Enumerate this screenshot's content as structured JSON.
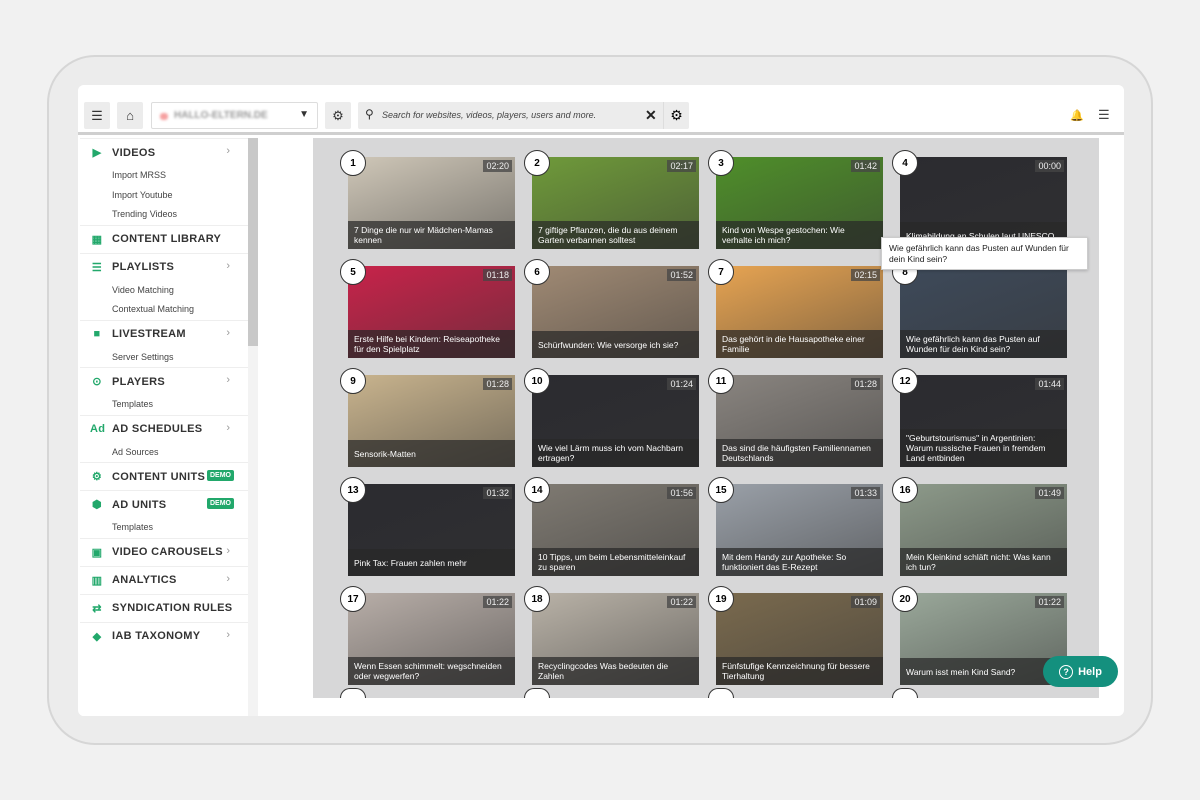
{
  "header": {
    "search_placeholder": "Search for websites, videos, players, users and more.",
    "site_selected": "HALLO-ELTERN.DE"
  },
  "sidebar": [
    {
      "label": "VIDEOS",
      "icon": "video-icon",
      "glyph": "▶",
      "chev": true,
      "subs": [
        "Import MRSS",
        "Import Youtube",
        "Trending Videos"
      ]
    },
    {
      "label": "CONTENT LIBRARY",
      "icon": "film-icon",
      "glyph": "▦",
      "chev": false,
      "subs": []
    },
    {
      "label": "PLAYLISTS",
      "icon": "list-icon",
      "glyph": "☰",
      "chev": true,
      "subs": [
        "Video Matching",
        "Contextual Matching"
      ]
    },
    {
      "label": "LIVESTREAM",
      "icon": "camera-icon",
      "glyph": "■",
      "chev": true,
      "subs": [
        "Server Settings"
      ]
    },
    {
      "label": "PLAYERS",
      "icon": "play-circle-icon",
      "glyph": "⊙",
      "chev": true,
      "subs": [
        "Templates"
      ]
    },
    {
      "label": "AD SCHEDULES",
      "icon": "ad-icon",
      "glyph": "Ad",
      "chev": true,
      "subs": [
        "Ad Sources"
      ]
    },
    {
      "label": "CONTENT UNITS",
      "icon": "gears-icon",
      "glyph": "⚙",
      "chev": false,
      "badge": "DEMO",
      "subs": []
    },
    {
      "label": "AD UNITS",
      "icon": "cube-icon",
      "glyph": "⬢",
      "chev": false,
      "badge": "DEMO",
      "subs": [
        "Templates"
      ]
    },
    {
      "label": "VIDEO CAROUSELS",
      "icon": "carousel-icon",
      "glyph": "▣",
      "chev": true,
      "subs": []
    },
    {
      "label": "ANALYTICS",
      "icon": "bar-chart-icon",
      "glyph": "▥",
      "chev": true,
      "subs": []
    },
    {
      "label": "SYNDICATION RULES",
      "icon": "exchange-icon",
      "glyph": "⇄",
      "chev": false,
      "subs": []
    },
    {
      "label": "IAB TAXONOMY",
      "icon": "tag-icon",
      "glyph": "◆",
      "chev": true,
      "subs": []
    }
  ],
  "videos": [
    {
      "n": "1",
      "dur": "02:20",
      "title": "7 Dinge die nur wir Mädchen-Mamas kennen",
      "bg": "#cfc7b8"
    },
    {
      "n": "2",
      "dur": "02:17",
      "title": "7 giftige Pflanzen, die du aus deinem Garten verbannen solltest",
      "bg": "#6f9a3a"
    },
    {
      "n": "3",
      "dur": "01:42",
      "title": "Kind von Wespe gestochen: Wie verhalte ich mich?",
      "bg": "#4f8f2a"
    },
    {
      "n": "4",
      "dur": "00:00",
      "title": "Klimabildung an Schulen laut UNESCO",
      "bg": "#2b2b30"
    },
    {
      "n": "5",
      "dur": "01:18",
      "title": "Erste Hilfe bei Kindern: Reiseapotheke für den Spielplatz",
      "bg": "#c8234a"
    },
    {
      "n": "6",
      "dur": "01:52",
      "title": "Schürfwunden: Wie versorge ich sie?",
      "bg": "#a08a74"
    },
    {
      "n": "7",
      "dur": "02:15",
      "title": "Das gehört in die Hausapotheke einer Familie",
      "bg": "#e7a452"
    },
    {
      "n": "8",
      "dur": "",
      "title": "Wie gefährlich kann das Pusten auf Wunden für dein Kind sein?",
      "bg": "#3e4a5a"
    },
    {
      "n": "9",
      "dur": "01:28",
      "title": "Sensorik-Matten",
      "bg": "#c9b48e"
    },
    {
      "n": "10",
      "dur": "01:24",
      "title": "Wie viel Lärm muss ich vom Nachbarn ertragen?",
      "bg": "#2b2b30"
    },
    {
      "n": "11",
      "dur": "01:28",
      "title": "Das sind die häufigsten Familiennamen Deutschlands",
      "bg": "#8a8580"
    },
    {
      "n": "12",
      "dur": "01:44",
      "title": "\"Geburtstourismus\" in Argentinien: Warum russische Frauen in fremdem Land entbinden",
      "bg": "#2b2b30"
    },
    {
      "n": "13",
      "dur": "01:32",
      "title": "Pink Tax: Frauen zahlen mehr",
      "bg": "#2b2b30"
    },
    {
      "n": "14",
      "dur": "01:56",
      "title": "10 Tipps, um beim Lebensmitteleinkauf zu sparen",
      "bg": "#7f7a72"
    },
    {
      "n": "15",
      "dur": "01:33",
      "title": "Mit dem Handy zur Apotheke: So funktioniert das E-Rezept",
      "bg": "#9aa0a8"
    },
    {
      "n": "16",
      "dur": "01:49",
      "title": "Mein Kleinkind schläft nicht: Was kann ich tun?",
      "bg": "#8d9a8a"
    },
    {
      "n": "17",
      "dur": "01:22",
      "title": "Wenn Essen schimmelt: wegschneiden oder wegwerfen?",
      "bg": "#b8aea8"
    },
    {
      "n": "18",
      "dur": "01:22",
      "title": "Recyclingcodes Was bedeuten die Zahlen",
      "bg": "#b9b2a7"
    },
    {
      "n": "19",
      "dur": "01:09",
      "title": "Fünfstufige Kennzeichnung für bessere Tierhaltung",
      "bg": "#7a6a4e"
    },
    {
      "n": "20",
      "dur": "01:22",
      "title": "Warum isst mein Kind Sand?",
      "bg": "#9aa89a"
    }
  ],
  "tooltip": "Wie gefährlich kann das Pusten auf Wunden für dein Kind sein?",
  "help_label": "Help",
  "colors": {
    "accent": "#22a86b",
    "help": "#14907e"
  }
}
